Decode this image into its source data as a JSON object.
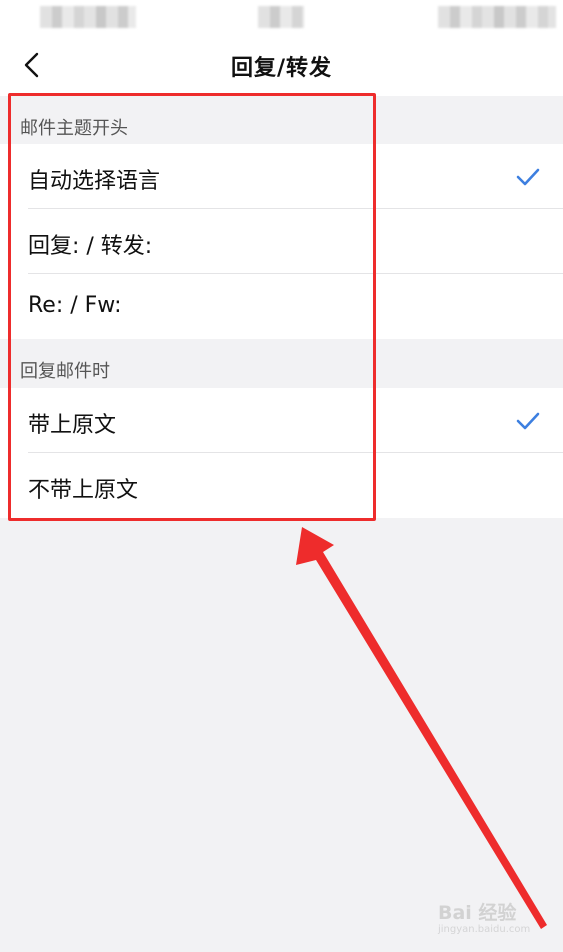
{
  "nav": {
    "title": "回复/转发",
    "back_icon": "chevron-left-icon"
  },
  "sections": [
    {
      "header": "邮件主题开头",
      "items": [
        {
          "label": "自动选择语言",
          "selected": true
        },
        {
          "label": "回复: / 转发:",
          "selected": false
        },
        {
          "label": "Re: /  Fw:",
          "selected": false
        }
      ]
    },
    {
      "header": "回复邮件时",
      "items": [
        {
          "label": "带上原文",
          "selected": true
        },
        {
          "label": "不带上原文",
          "selected": false
        }
      ]
    }
  ],
  "colors": {
    "accent_check": "#3d7fe0",
    "annotation_red": "#ee2c2c",
    "background": "#f2f2f4"
  },
  "watermark": {
    "main": "Bai 经验",
    "sub": "jingyan.baidu.com"
  }
}
